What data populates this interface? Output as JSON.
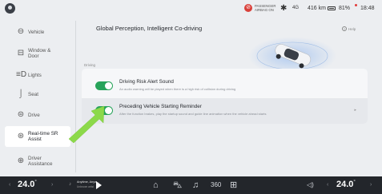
{
  "status": {
    "airbag": "PASSENGER AIRBAG ON",
    "signal": "4G",
    "range": "416 km",
    "battery": "81%",
    "time": "18:48"
  },
  "sidebar": {
    "items": [
      {
        "label": "Vehicle",
        "icon": "steering-wheel-icon"
      },
      {
        "label": "Window & Door",
        "icon": "window-icon"
      },
      {
        "label": "Lights",
        "icon": "headlight-icon"
      },
      {
        "label": "Seat",
        "icon": "seat-icon"
      },
      {
        "label": "Drive",
        "icon": "drive-wheel-icon"
      },
      {
        "label": "Real-time SR Assist",
        "icon": "sr-assist-icon"
      },
      {
        "label": "Driver Assistance",
        "icon": "driver-assist-icon"
      }
    ],
    "active_index": 5
  },
  "main": {
    "title": "Global Perception, Intelligent Co-driving",
    "help": "Help",
    "section_label": "Driving",
    "settings": [
      {
        "title": "Driving Risk Alert Sound",
        "description": "An audio warning will be played when there is a high risk of collision during driving",
        "enabled": true
      },
      {
        "title": "Preceding Vehicle Starting Reminder",
        "description": "After the function brakes, play the startup sound and guide line animation when the vehicle ahead starts",
        "enabled": true
      }
    ]
  },
  "bottom": {
    "temp_left": "24.0",
    "temp_right": "24.0",
    "temp_unit": "°",
    "media_title": "Anytime, Anyw...",
    "media_subtitle": "Unknown artist",
    "dock": [
      "home-icon",
      "car-icon",
      "music-icon",
      "360-view-icon",
      "apps-icon"
    ],
    "dock_360": "360"
  },
  "colors": {
    "toggle_on": "#27a35a",
    "arrow": "#8cd94a",
    "airbag": "#d9403a"
  }
}
